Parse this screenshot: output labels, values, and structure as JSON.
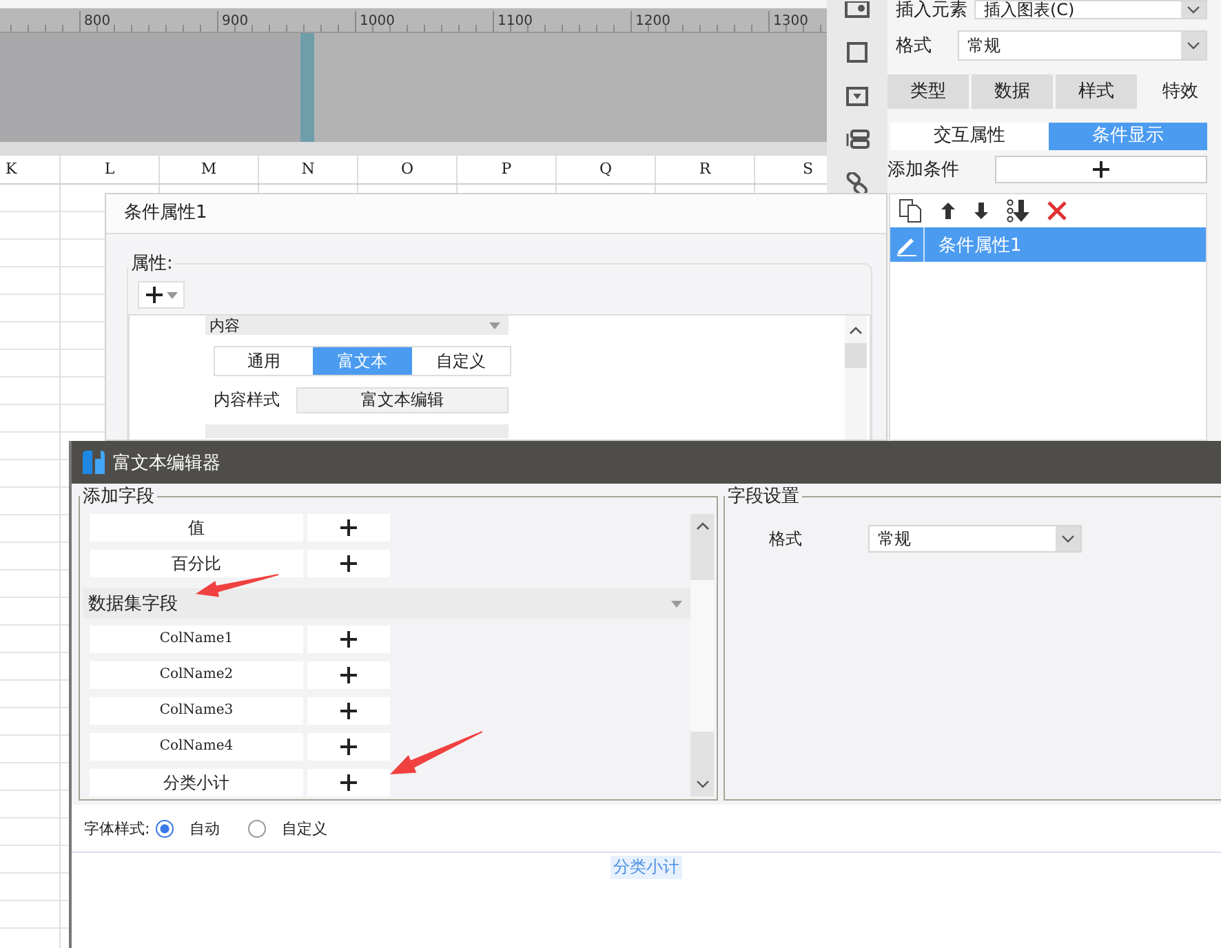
{
  "ruler": {
    "labels": [
      "800",
      "900",
      "1000",
      "1100",
      "1200",
      "1300"
    ]
  },
  "sheet": {
    "columns": [
      "K",
      "L",
      "M",
      "N",
      "O",
      "P",
      "Q",
      "R",
      "S"
    ]
  },
  "properties": {
    "insert": {
      "label": "插入元素",
      "value": "插入图表(C)"
    },
    "format": {
      "label": "格式",
      "value": "常规"
    },
    "tabs": [
      {
        "label": "类型",
        "selected": false
      },
      {
        "label": "数据",
        "selected": false
      },
      {
        "label": "样式",
        "selected": false
      },
      {
        "label": "特效",
        "selected": true
      }
    ],
    "subtabs": [
      {
        "label": "交互属性",
        "selected": false
      },
      {
        "label": "条件显示",
        "selected": true
      }
    ],
    "add_condition": {
      "label": "添加条件"
    },
    "conditions": [
      {
        "label": "条件属性1",
        "selected": true
      }
    ]
  },
  "condition_dialog": {
    "title": "条件属性1",
    "group_label": "属性:",
    "section": "内容",
    "modes": [
      {
        "label": "通用",
        "selected": false
      },
      {
        "label": "富文本",
        "selected": true
      },
      {
        "label": "自定义",
        "selected": false
      }
    ],
    "style_label": "内容样式",
    "style_button": "富文本编辑"
  },
  "editor": {
    "title": "富文本编辑器",
    "fields_group": "添加字段",
    "fields": [
      {
        "kind": "item",
        "label": "值"
      },
      {
        "kind": "item",
        "label": "百分比"
      },
      {
        "kind": "group",
        "label": "数据集字段"
      },
      {
        "kind": "item",
        "label": "ColName1"
      },
      {
        "kind": "item",
        "label": "ColName2"
      },
      {
        "kind": "item",
        "label": "ColName3"
      },
      {
        "kind": "item",
        "label": "ColName4"
      },
      {
        "kind": "item",
        "label": "分类小计"
      }
    ],
    "settings_group": "字段设置",
    "format": {
      "label": "格式",
      "value": "常规"
    },
    "font_style": {
      "label": "字体样式:",
      "options": [
        {
          "label": "自动",
          "selected": true
        },
        {
          "label": "自定义",
          "selected": false
        }
      ]
    },
    "content": "分类小计"
  }
}
